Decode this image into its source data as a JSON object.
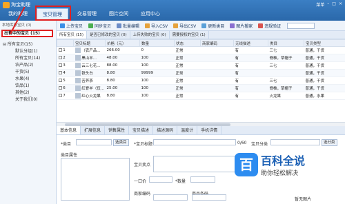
{
  "app": {
    "title": "淘宝助理",
    "main_tabs": [
      "我的助理",
      "宝贝管理",
      "交易管理",
      "图片空间",
      "应用中心"
    ],
    "active_tab": "宝贝管理",
    "window_controls": [
      "菜单",
      "–",
      "□",
      "×"
    ]
  },
  "toolbar": {
    "buttons": [
      "上传宝贝",
      "同步宝贝",
      "批量编辑",
      "导入CSV",
      "导出CSV",
      "更新类目",
      "图片搬家",
      "违规验证"
    ],
    "search_placeholder": ""
  },
  "sidebar": {
    "local_label": "本地库存宝贝 (0)",
    "selling_label": "出售中的宝贝 (15)",
    "tree_root": "所有宝贝(15)",
    "tree_children": [
      "默认分组(1)",
      "所有宝贝(14)",
      "农产品(2)",
      "干货(5)",
      "水果(4)",
      "饮品(1)",
      "其他(2)",
      "关于我们(0)"
    ]
  },
  "folder_tabs": [
    "所有宝贝 (15)",
    "是否已修改的宝贝 (0)",
    "上传失败的宝贝 (0)",
    "需要授权的宝贝 (1)"
  ],
  "grid": {
    "columns": [
      "",
      "宝贝标题",
      "价格（元）",
      "数量",
      "状态",
      "商家编码",
      "无线描述",
      "类目",
      "宝贝类型"
    ],
    "rows": [
      {
        "num": "1",
        "title": "（农产品...",
        "price": "266.00",
        "qty": "0",
        "status": "正常",
        "code": "",
        "wireless": "有",
        "category": "三七",
        "type": "普通，干货"
      },
      {
        "num": "2",
        "title": "黑山羊...",
        "price": "48.00",
        "qty": "100",
        "status": "正常",
        "code": "",
        "wireless": "有",
        "category": "脊椎，草帽子",
        "type": "普通，干货"
      },
      {
        "num": "3",
        "title": "云三七花...",
        "price": "88.00",
        "qty": "100",
        "status": "正常",
        "code": "",
        "wireless": "有",
        "category": "三七",
        "type": "普通，干货"
      },
      {
        "num": "4",
        "title": "铁头白",
        "price": "8.80",
        "qty": "99999",
        "status": "正常",
        "code": "",
        "wireless": "有",
        "category": "",
        "type": "普通，干货"
      },
      {
        "num": "5",
        "title": "苦荞茶",
        "price": "8.80",
        "qty": "100",
        "status": "正常",
        "code": "",
        "wireless": "有",
        "category": "三七",
        "type": "普通，干货"
      },
      {
        "num": "6",
        "title": "红脊羊（仅...",
        "price": "25.00",
        "qty": "100",
        "status": "正常",
        "code": "",
        "wireless": "有",
        "category": "脊椎，草帽子",
        "type": "普通，干货"
      },
      {
        "num": "7",
        "title": "红心火龙果",
        "price": "8.80",
        "qty": "100",
        "status": "正常",
        "code": "",
        "wireless": "有",
        "category": "火龙果",
        "type": "普通，水果"
      }
    ]
  },
  "detail_tabs": [
    "基本信息",
    "扩展信息",
    "销售属性",
    "宝贝描述",
    "描述源码",
    "温度计",
    "手机详情"
  ],
  "form": {
    "category_label": "*类目",
    "category_btn": "选类目",
    "attr_label": "类目属性",
    "title_label": "*宝贝标题",
    "title_counter": "0/60",
    "selling_points_label": "宝贝卖点",
    "price_label": "一口价",
    "qty_label": "*数量",
    "code_label": "商家编码",
    "barcode_label": "商品条码",
    "category_right": "宝贝分类",
    "category_right_btn": "选分类",
    "no_image": "暂无图片"
  },
  "watermark": {
    "logo": "百",
    "title": "百科全说",
    "subtitle": "助你轻松解决"
  }
}
